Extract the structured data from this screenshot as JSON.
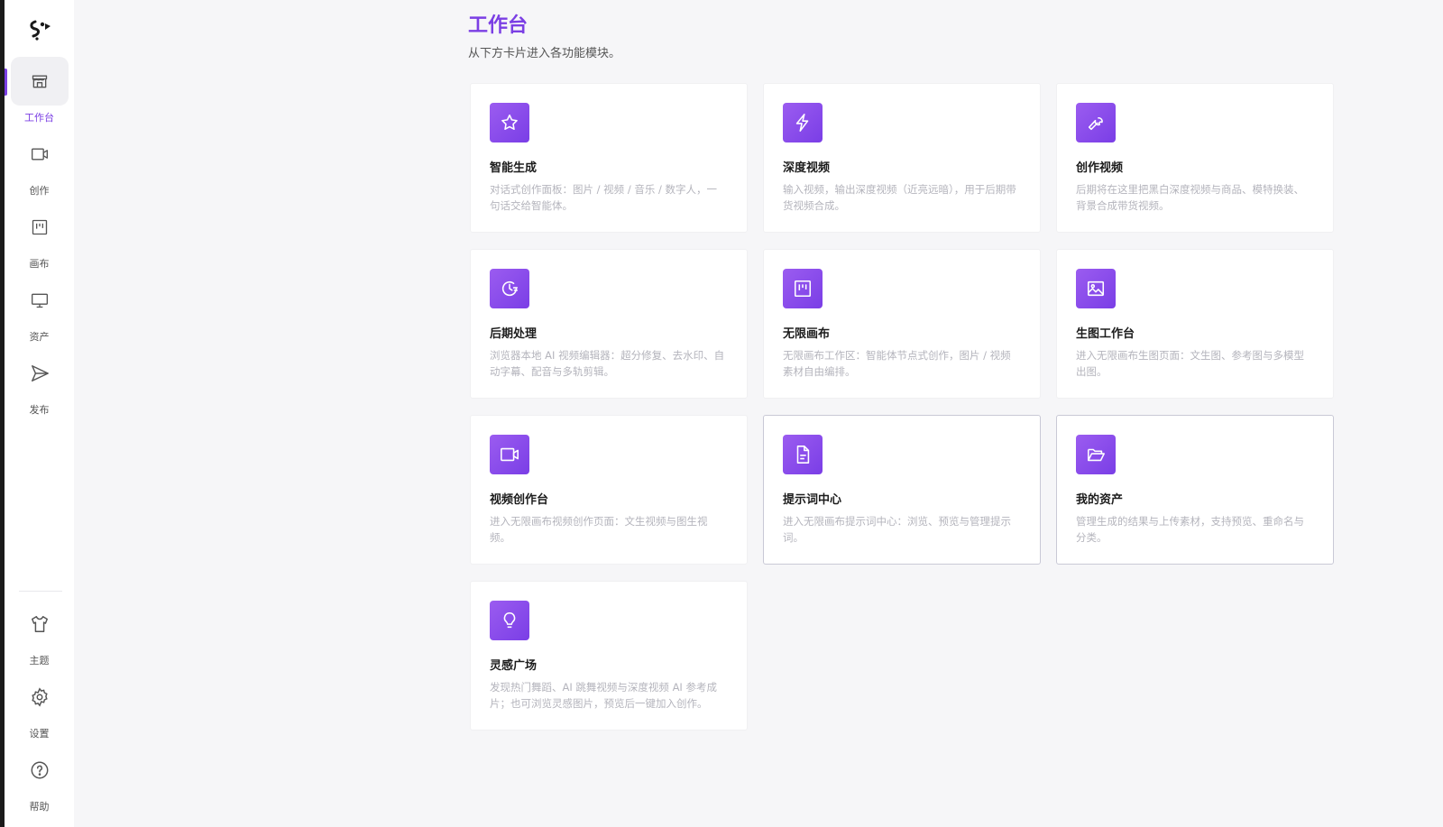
{
  "sidebar": {
    "nav": [
      {
        "label": "工作台",
        "icon": "store-icon",
        "active": true
      },
      {
        "label": "创作",
        "icon": "video-icon"
      },
      {
        "label": "画布",
        "icon": "canvas-icon"
      },
      {
        "label": "资产",
        "icon": "monitor-icon"
      },
      {
        "label": "发布",
        "icon": "send-icon"
      }
    ],
    "bottom": [
      {
        "label": "主题",
        "icon": "shirt-icon"
      },
      {
        "label": "设置",
        "icon": "gear-icon"
      },
      {
        "label": "帮助",
        "icon": "help-icon"
      }
    ]
  },
  "main": {
    "title": "工作台",
    "subtitle": "从下方卡片进入各功能模块。",
    "cards": [
      {
        "title": "智能生成",
        "desc": "对话式创作面板：图片 / 视频 / 音乐 / 数字人，一句话交给智能体。",
        "icon": "star-icon"
      },
      {
        "title": "深度视频",
        "desc": "输入视频，输出深度视频（近亮远暗），用于后期带货视频合成。",
        "icon": "lightning-icon"
      },
      {
        "title": "创作视频",
        "desc": "后期将在这里把黑白深度视频与商品、模特换装、背景合成带货视频。",
        "icon": "wrench-icon"
      },
      {
        "title": "后期处理",
        "desc": "浏览器本地 AI 视频编辑器：超分修复、去水印、自动字幕、配音与多轨剪辑。",
        "icon": "clock-icon"
      },
      {
        "title": "无限画布",
        "desc": "无限画布工作区：智能体节点式创作，图片 / 视频素材自由编排。",
        "icon": "canvas-icon"
      },
      {
        "title": "生图工作台",
        "desc": "进入无限画布生图页面：文生图、参考图与多模型出图。",
        "icon": "image-icon"
      },
      {
        "title": "视频创作台",
        "desc": "进入无限画布视频创作页面：文生视频与图生视频。",
        "icon": "video-icon"
      },
      {
        "title": "提示词中心",
        "desc": "进入无限画布提示词中心：浏览、预览与管理提示词。",
        "icon": "document-icon"
      },
      {
        "title": "我的资产",
        "desc": "管理生成的结果与上传素材，支持预览、重命名与分类。",
        "icon": "folder-icon"
      },
      {
        "title": "灵感广场",
        "desc": "发现热门舞蹈、AI 跳舞视频与深度视频 AI 参考成片；也可浏览灵感图片，预览后一键加入创作。",
        "icon": "lightbulb-icon"
      }
    ]
  },
  "colors": {
    "accent": "#7b3fe4",
    "icon_gradient_start": "#9b5cf0",
    "icon_gradient_end": "#7a3ee6"
  }
}
